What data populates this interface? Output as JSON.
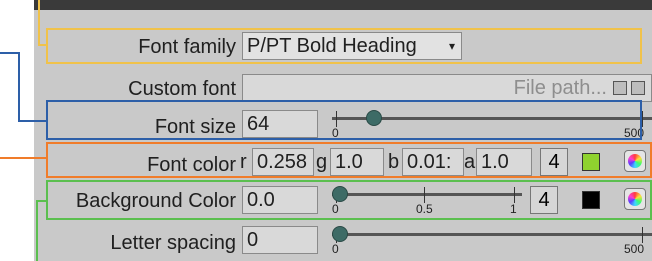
{
  "rows": {
    "font_family": {
      "label": "Font family",
      "value": "P/PT Bold Heading",
      "caret": "▾"
    },
    "custom_font": {
      "label": "Custom font",
      "placeholder": "File path..."
    },
    "font_size": {
      "label": "Font size",
      "value": "64",
      "slider_min": "0",
      "slider_max": "500",
      "level": 0.1
    },
    "font_color": {
      "label": "Font color",
      "r_label": "r",
      "r": "0.258",
      "g_label": "g",
      "g": "1.0",
      "b_label": "b",
      "b": "0.01:",
      "a_label": "a",
      "a": "1.0",
      "step": "4",
      "swatch_color": "#8fd22f"
    },
    "background_color": {
      "label": "Background Color",
      "value": "0.0",
      "slider_min": "0",
      "slider_mid": "0.5",
      "slider_max": "1",
      "step": "4",
      "swatch_color": "#000000",
      "level": 0.0
    },
    "letter_spacing": {
      "label": "Letter spacing",
      "value": "0",
      "slider_min": "0",
      "slider_max": "500",
      "level": 0.0
    }
  },
  "callout_colors": {
    "font_family": "#f0c24a",
    "font_size": "#2d5fa8",
    "font_color": "#f07c2a",
    "background_color": "#5bbf4f"
  }
}
